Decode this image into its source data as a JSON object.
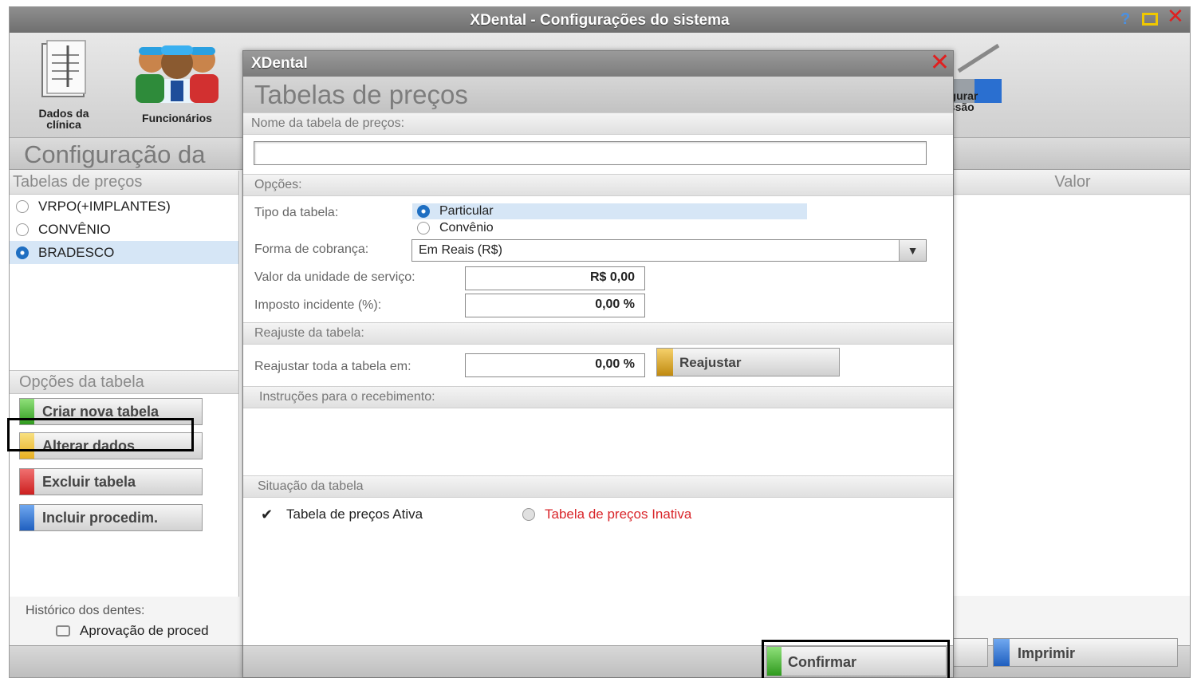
{
  "main_window": {
    "title": "XDental - Configurações do sistema",
    "toolbar": {
      "dados_clinica": "Dados da clínica",
      "funcionarios": "Funcionários",
      "config_partial": "figurar\nessão"
    },
    "heading": "Configuração da",
    "left_panel": {
      "title": "Tabelas de preços",
      "tables": [
        "VRPO(+IMPLANTES)",
        "CONVÊNIO",
        "BRADESCO"
      ],
      "selected": "BRADESCO"
    },
    "options_panel": {
      "title": "Opções da tabela",
      "buttons": {
        "criar": "Criar nova tabela",
        "alterar": "Alterar dados",
        "excluir": "Excluir tabela",
        "incluir": "Incluir procedim."
      }
    },
    "historico_label": "Histórico dos dentes:",
    "aprovacao_label": "Aprovação de proced",
    "valor_header": "Valor",
    "imprimir_label": "Imprimir"
  },
  "dialog": {
    "title": "XDental",
    "heading": "Tabelas de preços",
    "nome_section": "Nome da tabela de preços:",
    "nome_value": "",
    "opcoes_section": "Opções:",
    "tipo_label": "Tipo da tabela:",
    "tipo_options": [
      "Particular",
      "Convênio"
    ],
    "tipo_selected": "Particular",
    "forma_label": "Forma de cobrança:",
    "forma_value": "Em Reais (R$)",
    "valor_unidade_label": "Valor da unidade de serviço:",
    "valor_unidade_value": "R$ 0,00",
    "imposto_label": "Imposto incidente (%):",
    "imposto_value": "0,00 %",
    "reajuste_section": "Reajuste da tabela:",
    "reajustar_label": "Reajustar toda a tabela em:",
    "reajustar_value": "0,00 %",
    "reajustar_button": "Reajustar",
    "instrucoes_section": "Instruções para o recebimento:",
    "situacao_section": "Situação da tabela",
    "ativa_label": "Tabela de preços Ativa",
    "inativa_label": "Tabela de preços Inativa",
    "confirmar_button": "Confirmar"
  },
  "colors": {
    "green_stripe": "#2f9a1e",
    "yellow_stripe": "#e8b020",
    "red_stripe": "#cc1f1f",
    "blue_stripe": "#1f5fbf",
    "inactive_text": "#d9252a",
    "selection": "#d6e6f6"
  },
  "icons": {
    "close": "close-icon",
    "maximize": "maximize-icon",
    "help": "help-icon",
    "dropdown": "chevron-down-icon",
    "check": "check-icon"
  }
}
